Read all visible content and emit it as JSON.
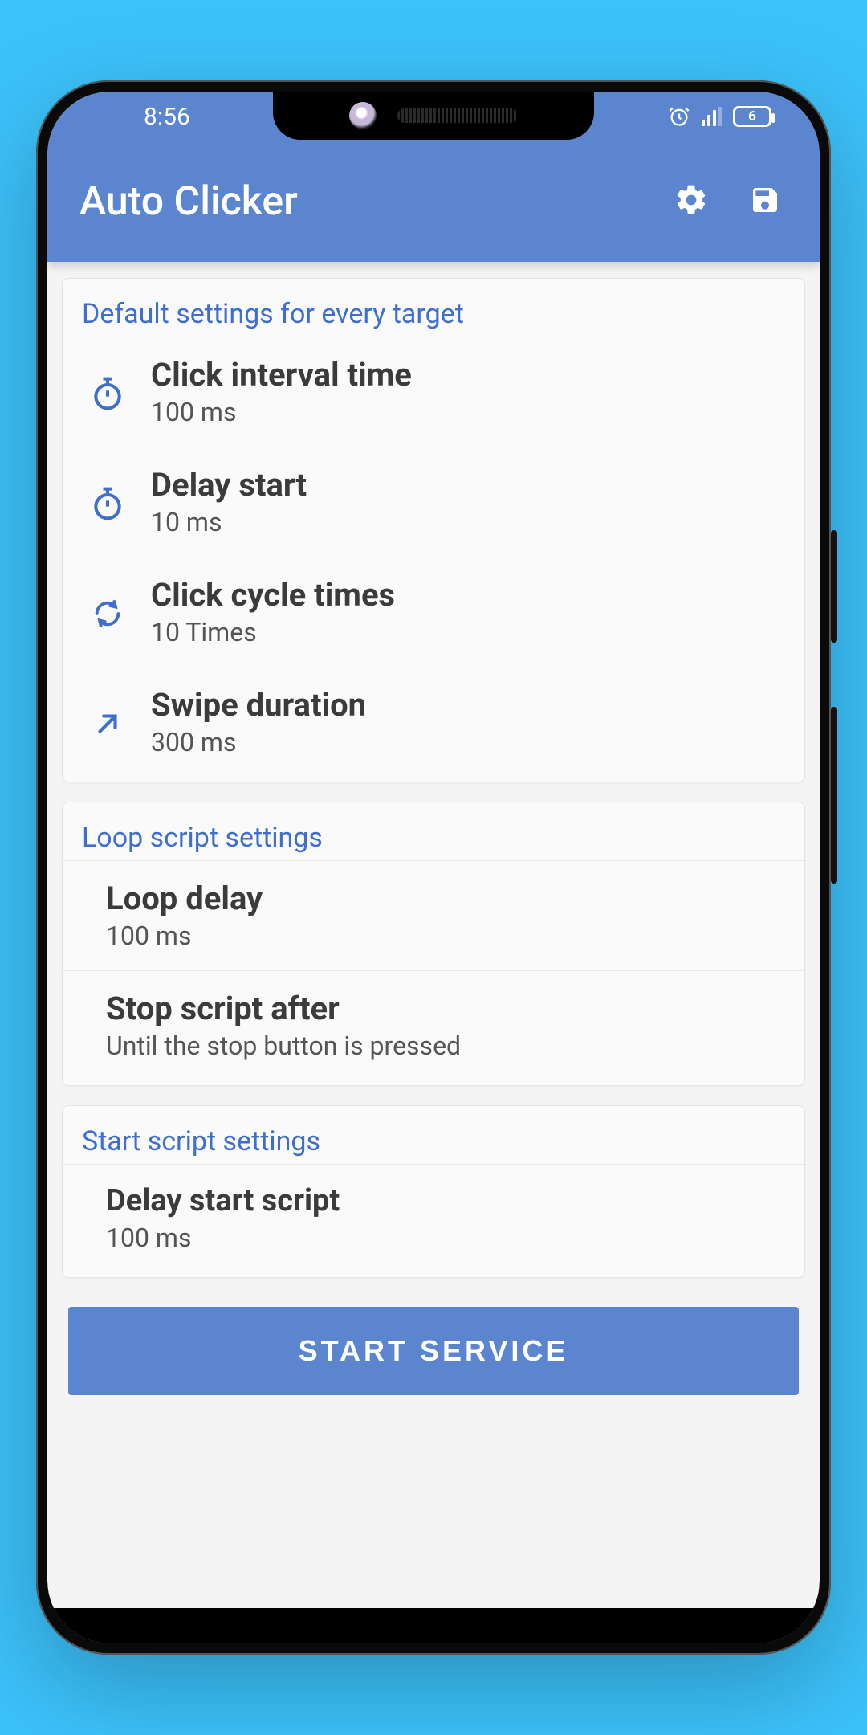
{
  "statusbar": {
    "time": "8:56",
    "battery": "6"
  },
  "appbar": {
    "title": "Auto Clicker"
  },
  "sections": {
    "defaults": {
      "header": "Default settings for every target",
      "click_interval": {
        "title": "Click interval time",
        "value": "100 ms"
      },
      "delay_start": {
        "title": "Delay start",
        "value": "10 ms"
      },
      "cycle_times": {
        "title": "Click cycle times",
        "value": "10 Times"
      },
      "swipe_duration": {
        "title": "Swipe duration",
        "value": "300 ms"
      }
    },
    "loop": {
      "header": "Loop script settings",
      "loop_delay": {
        "title": "Loop delay",
        "value": "100 ms"
      },
      "stop_after": {
        "title": "Stop script after",
        "value": "Until the stop button is pressed"
      }
    },
    "start": {
      "header": "Start script settings",
      "delay_start_script": {
        "title": "Delay start script",
        "value": "100 ms"
      }
    }
  },
  "footer": {
    "start_button": "START SERVICE"
  }
}
